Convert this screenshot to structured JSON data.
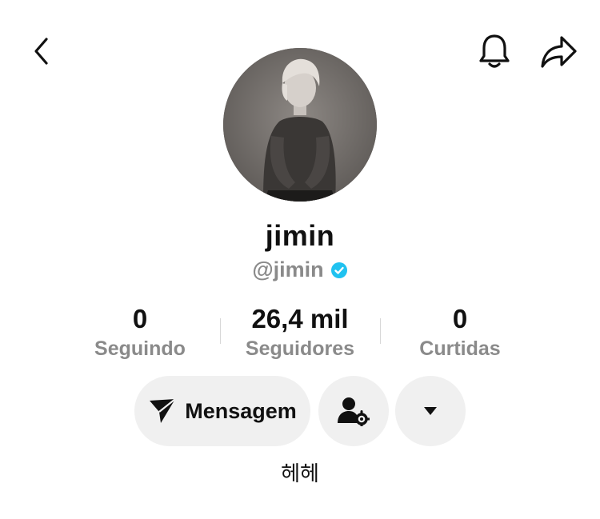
{
  "profile": {
    "display_name": "jimin",
    "handle": "@jimin",
    "bio": "헤헤"
  },
  "stats": [
    {
      "value": "0",
      "label": "Seguindo"
    },
    {
      "value": "26,4 mil",
      "label": "Seguidores"
    },
    {
      "value": "0",
      "label": "Curtidas"
    }
  ],
  "actions": {
    "message_label": "Mensagem"
  },
  "icons": {
    "back": "chevron-left-icon",
    "notifications": "bell-icon",
    "share": "share-arrow-icon",
    "verified": "verified-badge-icon",
    "message": "send-icon",
    "friend_settings": "user-gear-icon",
    "more": "caret-down-icon"
  },
  "colors": {
    "verified": "#20c2f0",
    "secondary_text": "#8a8a8a",
    "button_bg": "#f0f0f0"
  }
}
